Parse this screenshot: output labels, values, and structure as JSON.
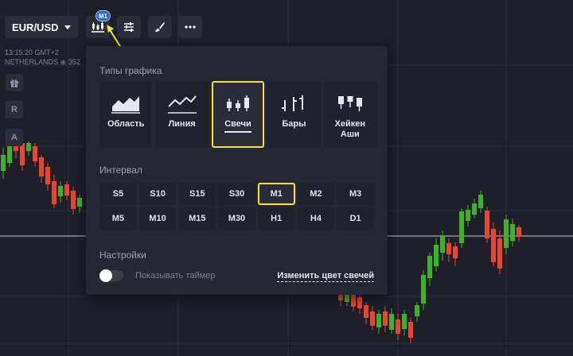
{
  "header": {
    "pair": "EUR/USD",
    "interval_badge": "M1",
    "icons": [
      "candles-chart-icon",
      "sliders-icon",
      "brush-icon",
      "more-icon"
    ]
  },
  "info": {
    "time": "13:15:20 GMT+2",
    "server": "NETHERLANDS",
    "ping": "352"
  },
  "side_tools": [
    "gift-icon",
    "R",
    "A"
  ],
  "panel": {
    "chart_types_title": "Типы графика",
    "chart_types": [
      {
        "label": "Область",
        "icon": "area-chart-icon",
        "selected": false
      },
      {
        "label": "Линия",
        "icon": "line-chart-icon",
        "selected": false
      },
      {
        "label": "Свечи",
        "icon": "candles-icon",
        "selected": true
      },
      {
        "label": "Бары",
        "icon": "bars-icon",
        "selected": false
      },
      {
        "label": "Хейкен Аши",
        "icon": "heikin-ashi-icon",
        "selected": false
      }
    ],
    "interval_title": "Интервал",
    "intervals": [
      "S5",
      "S10",
      "S15",
      "S30",
      "M1",
      "M2",
      "M3",
      "M5",
      "M10",
      "M15",
      "M30",
      "H1",
      "H4",
      "D1"
    ],
    "selected_interval": "M1",
    "settings_title": "Настройки",
    "show_timer_label": "Показывать таймер",
    "show_timer_on": false,
    "change_color_link": "Изменить цвет свечей"
  },
  "colors": {
    "background": "#1e1f29",
    "panel": "#252732",
    "bull": "#3fb327",
    "bear": "#e8452f",
    "highlight": "#f2e23a",
    "badge": "#2f67c8"
  }
}
